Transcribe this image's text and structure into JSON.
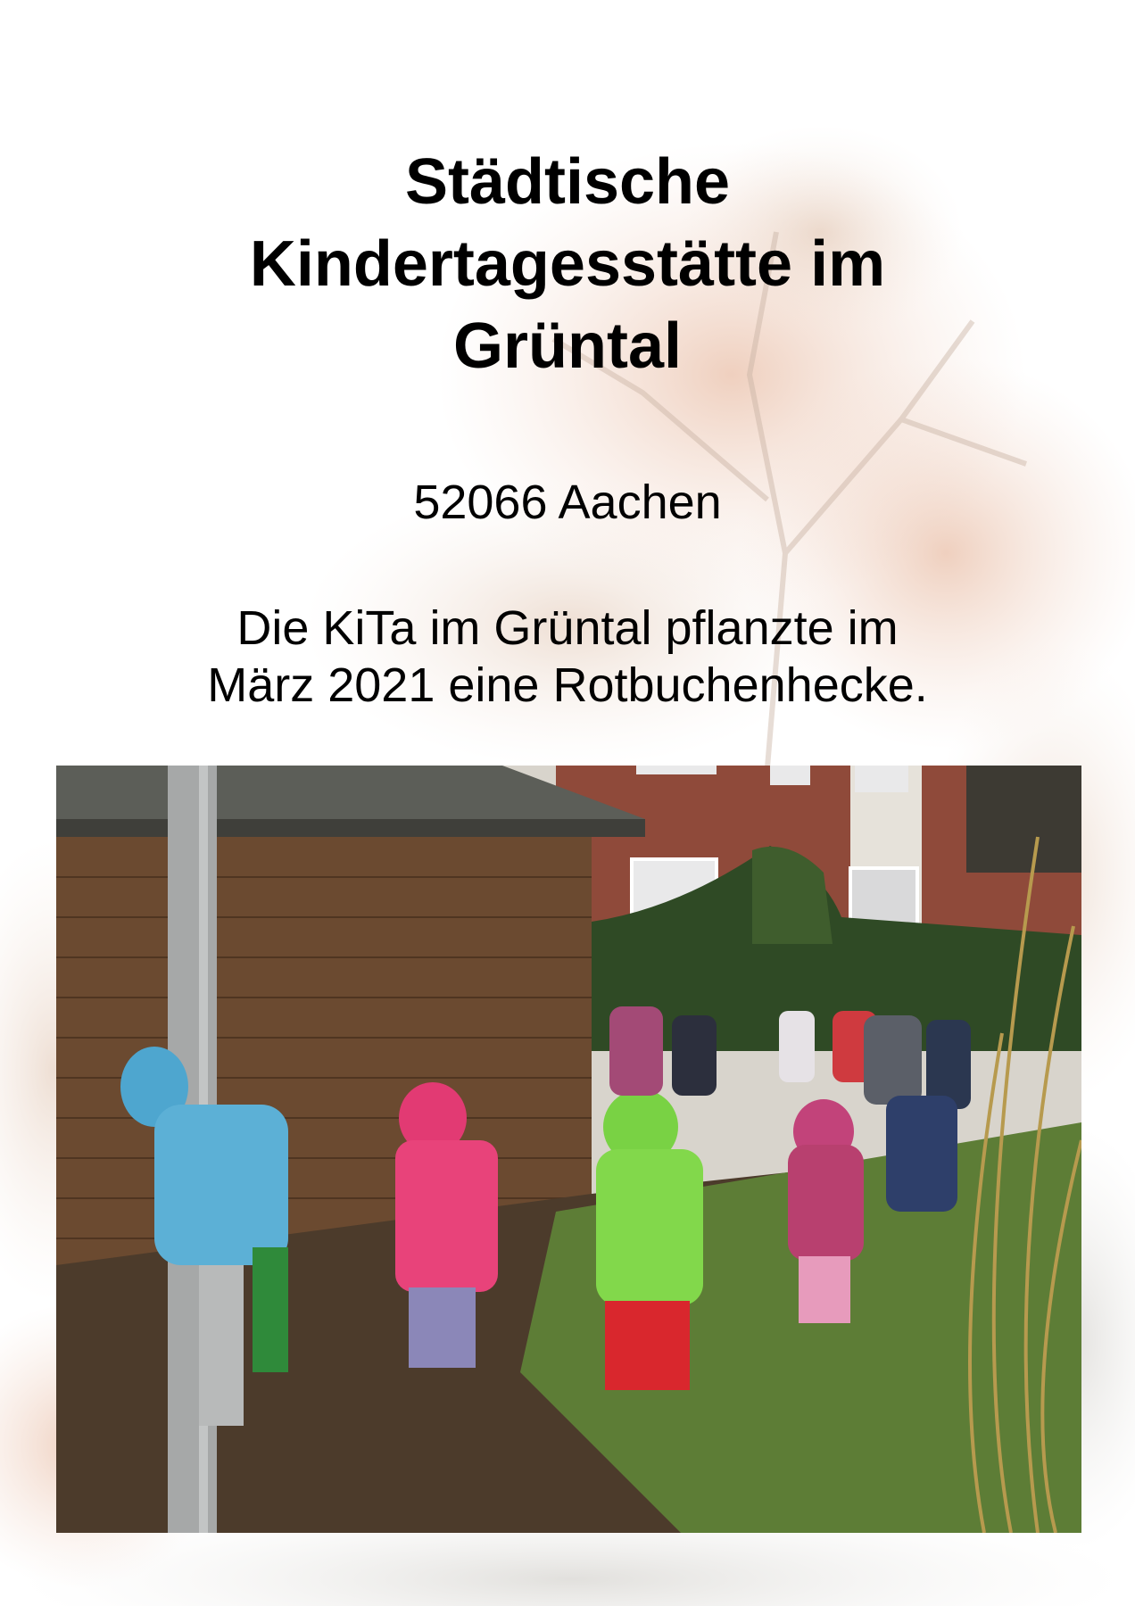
{
  "document": {
    "title_lines": [
      "Städtische",
      "Kindertagesstätte im",
      "Grüntal"
    ],
    "city": "52066 Aachen",
    "description_lines": [
      "Die KiTa im Grüntal pflanzte im",
      "März 2021 eine Rotbuchenhecke."
    ]
  },
  "colors": {
    "text": "#000000",
    "background_foliage": "#e9c4ad",
    "brick": "#8f4a3a",
    "shed_wood": "#6b4a30",
    "grass": "#5d7d36"
  }
}
